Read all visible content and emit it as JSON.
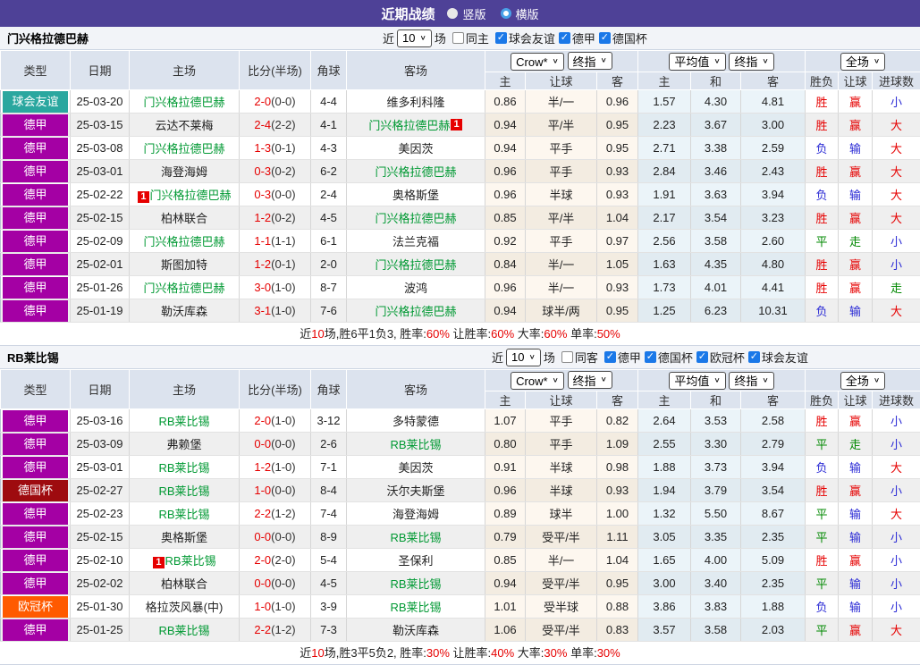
{
  "icons": {
    "chevron": "∨",
    "check": "✓"
  },
  "colors": {
    "title_bar": "#4e4197",
    "team_link": "#009933",
    "score_red": "#e60000",
    "result": {
      "r": "#e60000",
      "g": "#008800",
      "b": "#2b2bd5"
    },
    "comp": {
      "球会友谊": "#2aa79f",
      "德甲": "#a400a4",
      "德国杯": "#9e0b0f",
      "欧冠杯": "#ff5a00"
    }
  },
  "title_bar": {
    "title": "近期战绩",
    "radio_vertical": "竖版",
    "radio_horizontal": "横版",
    "selected": "横版"
  },
  "columns": {
    "type": "类型",
    "date": "日期",
    "home": "主场",
    "score": "比分(半场)",
    "corner": "角球",
    "away": "客场",
    "dd_crow": "Crow*",
    "dd_final": "终指",
    "dd_avg": "平均值",
    "dd_final2": "终指",
    "dd_full": "全场",
    "crow_home": "主",
    "crow_hand": "让球",
    "crow_away": "客",
    "avg_home": "主",
    "avg_draw": "和",
    "avg_away": "客",
    "res_wdl": "胜负",
    "res_hand": "让球",
    "res_goals": "进球数"
  },
  "sections": [
    {
      "team": "门兴格拉德巴赫",
      "filter": {
        "near": "近",
        "count": "10",
        "games": "场",
        "same": "同主",
        "same_checked": false,
        "competitions": [
          "球会友谊",
          "德甲",
          "德国杯"
        ]
      },
      "rows": [
        {
          "comp": "球会友谊",
          "date": "25-03-20",
          "home": {
            "n": "门兴格拉德巴赫",
            "t": 1
          },
          "away": {
            "n": "维多利科隆"
          },
          "ft": "2-0",
          "ht": "(0-0)",
          "cn": "4-4",
          "odds": [
            "0.86",
            "半/一",
            "0.96"
          ],
          "avg": [
            "1.57",
            "4.30",
            "4.81"
          ],
          "res": [
            [
              "胜",
              "r"
            ],
            [
              "赢",
              "r"
            ],
            [
              "小",
              "b"
            ]
          ]
        },
        {
          "comp": "德甲",
          "date": "25-03-15",
          "home": {
            "n": "云达不莱梅"
          },
          "away": {
            "n": "门兴格拉德巴赫",
            "t": 1,
            "m": "1",
            "mp": "after"
          },
          "ft": "2-4",
          "ht": "(2-2)",
          "cn": "4-1",
          "odds": [
            "0.94",
            "平/半",
            "0.95"
          ],
          "avg": [
            "2.23",
            "3.67",
            "3.00"
          ],
          "res": [
            [
              "胜",
              "r"
            ],
            [
              "赢",
              "r"
            ],
            [
              "大",
              "r"
            ]
          ]
        },
        {
          "comp": "德甲",
          "date": "25-03-08",
          "home": {
            "n": "门兴格拉德巴赫",
            "t": 1
          },
          "away": {
            "n": "美因茨"
          },
          "ft": "1-3",
          "ht": "(0-1)",
          "cn": "4-3",
          "odds": [
            "0.94",
            "平手",
            "0.95"
          ],
          "avg": [
            "2.71",
            "3.38",
            "2.59"
          ],
          "res": [
            [
              "负",
              "b"
            ],
            [
              "输",
              "b"
            ],
            [
              "大",
              "r"
            ]
          ]
        },
        {
          "comp": "德甲",
          "date": "25-03-01",
          "home": {
            "n": "海登海姆"
          },
          "away": {
            "n": "门兴格拉德巴赫",
            "t": 1
          },
          "ft": "0-3",
          "ht": "(0-2)",
          "cn": "6-2",
          "odds": [
            "0.96",
            "平手",
            "0.93"
          ],
          "avg": [
            "2.84",
            "3.46",
            "2.43"
          ],
          "res": [
            [
              "胜",
              "r"
            ],
            [
              "赢",
              "r"
            ],
            [
              "大",
              "r"
            ]
          ]
        },
        {
          "comp": "德甲",
          "date": "25-02-22",
          "home": {
            "n": "门兴格拉德巴赫",
            "t": 1,
            "m": "1",
            "mp": "before"
          },
          "away": {
            "n": "奥格斯堡"
          },
          "ft": "0-3",
          "ht": "(0-0)",
          "cn": "2-4",
          "odds": [
            "0.96",
            "半球",
            "0.93"
          ],
          "avg": [
            "1.91",
            "3.63",
            "3.94"
          ],
          "res": [
            [
              "负",
              "b"
            ],
            [
              "输",
              "b"
            ],
            [
              "大",
              "r"
            ]
          ]
        },
        {
          "comp": "德甲",
          "date": "25-02-15",
          "home": {
            "n": "柏林联合"
          },
          "away": {
            "n": "门兴格拉德巴赫",
            "t": 1
          },
          "ft": "1-2",
          "ht": "(0-2)",
          "cn": "4-5",
          "odds": [
            "0.85",
            "平/半",
            "1.04"
          ],
          "avg": [
            "2.17",
            "3.54",
            "3.23"
          ],
          "res": [
            [
              "胜",
              "r"
            ],
            [
              "赢",
              "r"
            ],
            [
              "大",
              "r"
            ]
          ]
        },
        {
          "comp": "德甲",
          "date": "25-02-09",
          "home": {
            "n": "门兴格拉德巴赫",
            "t": 1
          },
          "away": {
            "n": "法兰克福"
          },
          "ft": "1-1",
          "ht": "(1-1)",
          "cn": "6-1",
          "odds": [
            "0.92",
            "平手",
            "0.97"
          ],
          "avg": [
            "2.56",
            "3.58",
            "2.60"
          ],
          "res": [
            [
              "平",
              "g"
            ],
            [
              "走",
              "g"
            ],
            [
              "小",
              "b"
            ]
          ]
        },
        {
          "comp": "德甲",
          "date": "25-02-01",
          "home": {
            "n": "斯图加特"
          },
          "away": {
            "n": "门兴格拉德巴赫",
            "t": 1
          },
          "ft": "1-2",
          "ht": "(0-1)",
          "cn": "2-0",
          "odds": [
            "0.84",
            "半/一",
            "1.05"
          ],
          "avg": [
            "1.63",
            "4.35",
            "4.80"
          ],
          "res": [
            [
              "胜",
              "r"
            ],
            [
              "赢",
              "r"
            ],
            [
              "小",
              "b"
            ]
          ]
        },
        {
          "comp": "德甲",
          "date": "25-01-26",
          "home": {
            "n": "门兴格拉德巴赫",
            "t": 1
          },
          "away": {
            "n": "波鸿"
          },
          "ft": "3-0",
          "ht": "(1-0)",
          "cn": "8-7",
          "odds": [
            "0.96",
            "半/一",
            "0.93"
          ],
          "avg": [
            "1.73",
            "4.01",
            "4.41"
          ],
          "res": [
            [
              "胜",
              "r"
            ],
            [
              "赢",
              "r"
            ],
            [
              "走",
              "g"
            ]
          ]
        },
        {
          "comp": "德甲",
          "date": "25-01-19",
          "home": {
            "n": "勒沃库森"
          },
          "away": {
            "n": "门兴格拉德巴赫",
            "t": 1
          },
          "ft": "3-1",
          "ht": "(1-0)",
          "cn": "7-6",
          "odds": [
            "0.94",
            "球半/两",
            "0.95"
          ],
          "avg": [
            "1.25",
            "6.23",
            "10.31"
          ],
          "res": [
            [
              "负",
              "b"
            ],
            [
              "输",
              "b"
            ],
            [
              "大",
              "r"
            ]
          ]
        }
      ],
      "summary": [
        [
          "近",
          "k"
        ],
        [
          "10",
          "r"
        ],
        [
          "场,胜6平1负3, 胜率:",
          "k"
        ],
        [
          "60%",
          "r"
        ],
        [
          " 让胜率:",
          "k"
        ],
        [
          "60%",
          "r"
        ],
        [
          " 大率:",
          "k"
        ],
        [
          "60%",
          "r"
        ],
        [
          " 单率:",
          "k"
        ],
        [
          "50%",
          "r"
        ]
      ]
    },
    {
      "team": "RB莱比锡",
      "filter": {
        "near": "近",
        "count": "10",
        "games": "场",
        "same": "同客",
        "same_checked": false,
        "competitions": [
          "德甲",
          "德国杯",
          "欧冠杯",
          "球会友谊"
        ]
      },
      "rows": [
        {
          "comp": "德甲",
          "date": "25-03-16",
          "home": {
            "n": "RB莱比锡",
            "t": 1
          },
          "away": {
            "n": "多特蒙德"
          },
          "ft": "2-0",
          "ht": "(1-0)",
          "cn": "3-12",
          "odds": [
            "1.07",
            "平手",
            "0.82"
          ],
          "avg": [
            "2.64",
            "3.53",
            "2.58"
          ],
          "res": [
            [
              "胜",
              "r"
            ],
            [
              "赢",
              "r"
            ],
            [
              "小",
              "b"
            ]
          ]
        },
        {
          "comp": "德甲",
          "date": "25-03-09",
          "home": {
            "n": "弗赖堡"
          },
          "away": {
            "n": "RB莱比锡",
            "t": 1
          },
          "ft": "0-0",
          "ht": "(0-0)",
          "cn": "2-6",
          "odds": [
            "0.80",
            "平手",
            "1.09"
          ],
          "avg": [
            "2.55",
            "3.30",
            "2.79"
          ],
          "res": [
            [
              "平",
              "g"
            ],
            [
              "走",
              "g"
            ],
            [
              "小",
              "b"
            ]
          ]
        },
        {
          "comp": "德甲",
          "date": "25-03-01",
          "home": {
            "n": "RB莱比锡",
            "t": 1
          },
          "away": {
            "n": "美因茨"
          },
          "ft": "1-2",
          "ht": "(1-0)",
          "cn": "7-1",
          "odds": [
            "0.91",
            "半球",
            "0.98"
          ],
          "avg": [
            "1.88",
            "3.73",
            "3.94"
          ],
          "res": [
            [
              "负",
              "b"
            ],
            [
              "输",
              "b"
            ],
            [
              "大",
              "r"
            ]
          ]
        },
        {
          "comp": "德国杯",
          "date": "25-02-27",
          "home": {
            "n": "RB莱比锡",
            "t": 1
          },
          "away": {
            "n": "沃尔夫斯堡"
          },
          "ft": "1-0",
          "ht": "(0-0)",
          "cn": "8-4",
          "odds": [
            "0.96",
            "半球",
            "0.93"
          ],
          "avg": [
            "1.94",
            "3.79",
            "3.54"
          ],
          "res": [
            [
              "胜",
              "r"
            ],
            [
              "赢",
              "r"
            ],
            [
              "小",
              "b"
            ]
          ]
        },
        {
          "comp": "德甲",
          "date": "25-02-23",
          "home": {
            "n": "RB莱比锡",
            "t": 1
          },
          "away": {
            "n": "海登海姆"
          },
          "ft": "2-2",
          "ht": "(1-2)",
          "cn": "7-4",
          "odds": [
            "0.89",
            "球半",
            "1.00"
          ],
          "avg": [
            "1.32",
            "5.50",
            "8.67"
          ],
          "res": [
            [
              "平",
              "g"
            ],
            [
              "输",
              "b"
            ],
            [
              "大",
              "r"
            ]
          ]
        },
        {
          "comp": "德甲",
          "date": "25-02-15",
          "home": {
            "n": "奥格斯堡"
          },
          "away": {
            "n": "RB莱比锡",
            "t": 1
          },
          "ft": "0-0",
          "ht": "(0-0)",
          "cn": "8-9",
          "odds": [
            "0.79",
            "受平/半",
            "1.11"
          ],
          "avg": [
            "3.05",
            "3.35",
            "2.35"
          ],
          "res": [
            [
              "平",
              "g"
            ],
            [
              "输",
              "b"
            ],
            [
              "小",
              "b"
            ]
          ]
        },
        {
          "comp": "德甲",
          "date": "25-02-10",
          "home": {
            "n": "RB莱比锡",
            "t": 1,
            "m": "1",
            "mp": "before"
          },
          "away": {
            "n": "圣保利"
          },
          "ft": "2-0",
          "ht": "(2-0)",
          "cn": "5-4",
          "odds": [
            "0.85",
            "半/一",
            "1.04"
          ],
          "avg": [
            "1.65",
            "4.00",
            "5.09"
          ],
          "res": [
            [
              "胜",
              "r"
            ],
            [
              "赢",
              "r"
            ],
            [
              "小",
              "b"
            ]
          ]
        },
        {
          "comp": "德甲",
          "date": "25-02-02",
          "home": {
            "n": "柏林联合"
          },
          "away": {
            "n": "RB莱比锡",
            "t": 1
          },
          "ft": "0-0",
          "ht": "(0-0)",
          "cn": "4-5",
          "odds": [
            "0.94",
            "受平/半",
            "0.95"
          ],
          "avg": [
            "3.00",
            "3.40",
            "2.35"
          ],
          "res": [
            [
              "平",
              "g"
            ],
            [
              "输",
              "b"
            ],
            [
              "小",
              "b"
            ]
          ]
        },
        {
          "comp": "欧冠杯",
          "date": "25-01-30",
          "home": {
            "n": "格拉茨风暴(中)"
          },
          "away": {
            "n": "RB莱比锡",
            "t": 1
          },
          "ft": "1-0",
          "ht": "(1-0)",
          "cn": "3-9",
          "odds": [
            "1.01",
            "受半球",
            "0.88"
          ],
          "avg": [
            "3.86",
            "3.83",
            "1.88"
          ],
          "res": [
            [
              "负",
              "b"
            ],
            [
              "输",
              "b"
            ],
            [
              "小",
              "b"
            ]
          ]
        },
        {
          "comp": "德甲",
          "date": "25-01-25",
          "home": {
            "n": "RB莱比锡",
            "t": 1
          },
          "away": {
            "n": "勒沃库森"
          },
          "ft": "2-2",
          "ht": "(1-2)",
          "cn": "7-3",
          "odds": [
            "1.06",
            "受平/半",
            "0.83"
          ],
          "avg": [
            "3.57",
            "3.58",
            "2.03"
          ],
          "res": [
            [
              "平",
              "g"
            ],
            [
              "赢",
              "r"
            ],
            [
              "大",
              "r"
            ]
          ]
        }
      ],
      "summary": [
        [
          "近",
          "k"
        ],
        [
          "10",
          "r"
        ],
        [
          "场,胜3平5负2, 胜率:",
          "k"
        ],
        [
          "30%",
          "r"
        ],
        [
          " 让胜率:",
          "k"
        ],
        [
          "40%",
          "r"
        ],
        [
          " 大率:",
          "k"
        ],
        [
          "30%",
          "r"
        ],
        [
          " 单率:",
          "k"
        ],
        [
          "30%",
          "r"
        ]
      ]
    }
  ]
}
